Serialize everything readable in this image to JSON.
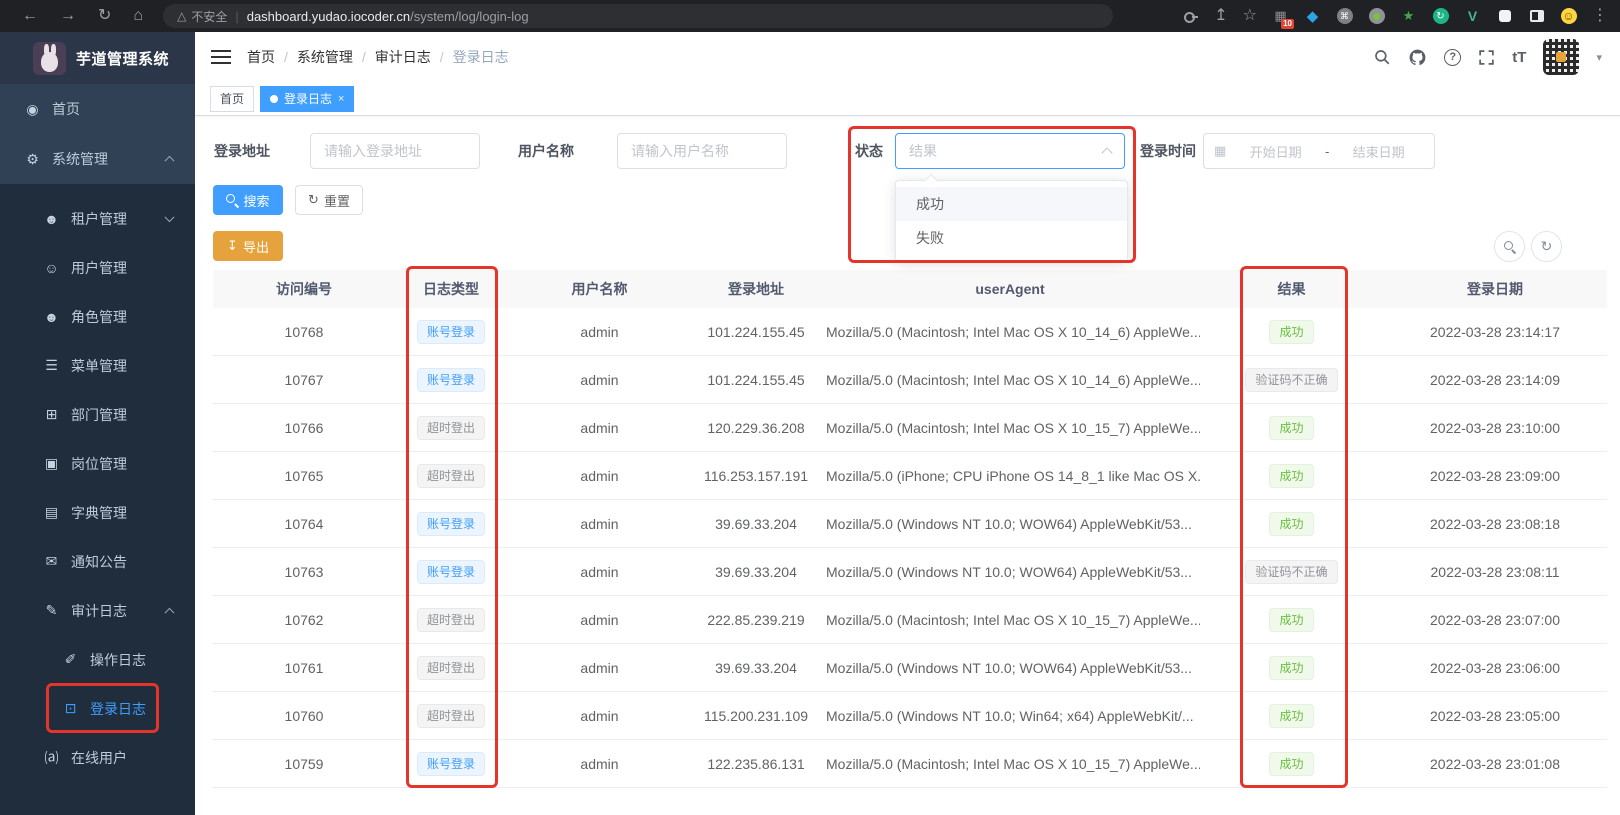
{
  "browser": {
    "security_text": "不安全",
    "url_host": "dashboard.yudao.iocoder.cn",
    "url_path": "/system/log/login-log",
    "extension_badge": "10"
  },
  "app": {
    "title": "芋道管理系统"
  },
  "icons": {
    "back": "←",
    "forward": "→",
    "reload": "↻",
    "home": "⌂",
    "warning_triangle": "△",
    "url_divider": "|",
    "share": "↥",
    "star": "☆",
    "browser_dots": "⋮",
    "ext_tiles": "▦",
    "ext_diamond": "◆",
    "ext_command": "⌘",
    "ext_star": "★",
    "ext_refresh": "↻",
    "ext_vue": "V",
    "ext_smiley": "☺",
    "help": "?",
    "font_size": "tT",
    "caret_down": "▾",
    "breadcrumb_sep": "/",
    "tab_close": "×",
    "reset": "↻",
    "export": "↧",
    "calendar": "▦",
    "refresh": "↻"
  },
  "breadcrumb": [
    "首页",
    "系统管理",
    "审计日志",
    "登录日志"
  ],
  "tabs": [
    {
      "name": "home",
      "label": "首页",
      "active": false,
      "closable": false
    },
    {
      "name": "login-log",
      "label": "登录日志",
      "active": true,
      "closable": true
    }
  ],
  "sidebar_menu": [
    {
      "name": "home",
      "label": "首页",
      "icon": "dashboard-icon",
      "glyph": "◉",
      "level": 0
    },
    {
      "name": "system-management",
      "label": "系统管理",
      "icon": "gear-icon",
      "glyph": "⚙",
      "level": 0,
      "arrow": "up"
    },
    {
      "name": "tenant-management",
      "label": "租户管理",
      "icon": "tenant-users-icon",
      "glyph": "☻",
      "level": 1,
      "arrow": "down"
    },
    {
      "name": "user-management",
      "label": "用户管理",
      "icon": "user-icon",
      "glyph": "☺",
      "level": 1
    },
    {
      "name": "role-management",
      "label": "角色管理",
      "icon": "role-users-icon",
      "glyph": "☻",
      "level": 1
    },
    {
      "name": "menu-management",
      "label": "菜单管理",
      "icon": "menu-tree-icon",
      "glyph": "☰",
      "level": 1
    },
    {
      "name": "dept-management",
      "label": "部门管理",
      "icon": "org-chart-icon",
      "glyph": "⊞",
      "level": 1
    },
    {
      "name": "post-management",
      "label": "岗位管理",
      "icon": "post-badge-icon",
      "glyph": "▣",
      "level": 1
    },
    {
      "name": "dict-management",
      "label": "字典管理",
      "icon": "dictionary-icon",
      "glyph": "▤",
      "level": 1
    },
    {
      "name": "notice",
      "label": "通知公告",
      "icon": "notice-message-icon",
      "glyph": "✉",
      "level": 1
    },
    {
      "name": "audit-log",
      "label": "审计日志",
      "icon": "audit-pencil-icon",
      "glyph": "✎",
      "level": 1,
      "arrow": "up"
    },
    {
      "name": "operation-log",
      "label": "操作日志",
      "icon": "operation-log-icon",
      "glyph": "✐",
      "level": 2
    },
    {
      "name": "login-log",
      "label": "登录日志",
      "icon": "login-log-icon",
      "glyph": "⊡",
      "level": 2,
      "active": true
    },
    {
      "name": "online-users",
      "label": "在线用户",
      "icon": "online-users-icon",
      "glyph": "⒜",
      "level": 1
    }
  ],
  "filters": {
    "login_address_label": "登录地址",
    "login_address_placeholder": "请输入登录地址",
    "username_label": "用户名称",
    "username_placeholder": "请输入用户名称",
    "status_label": "状态",
    "status_placeholder": "结果",
    "login_time_label": "登录时间",
    "date_start_placeholder": "开始日期",
    "date_separator": "-",
    "date_end_placeholder": "结束日期"
  },
  "status_dropdown": {
    "options": [
      {
        "label": "成功",
        "hover": true
      },
      {
        "label": "失败",
        "hover": false
      }
    ]
  },
  "toolbar": {
    "search_label": "搜索",
    "reset_label": "重置",
    "export_label": "导出"
  },
  "table": {
    "columns": [
      "访问编号",
      "日志类型",
      "用户名称",
      "登录地址",
      "userAgent",
      "结果",
      "登录日期"
    ],
    "rows": [
      {
        "id": "10768",
        "log_type": "账号登录",
        "log_type_variant": "blue",
        "username": "admin",
        "ip": "101.224.155.45",
        "user_agent": "Mozilla/5.0 (Macintosh; Intel Mac OS X 10_14_6) AppleWe...",
        "result": "成功",
        "result_variant": "green",
        "date": "2022-03-28 23:14:17"
      },
      {
        "id": "10767",
        "log_type": "账号登录",
        "log_type_variant": "blue",
        "username": "admin",
        "ip": "101.224.155.45",
        "user_agent": "Mozilla/5.0 (Macintosh; Intel Mac OS X 10_14_6) AppleWe...",
        "result": "验证码不正确",
        "result_variant": "grey",
        "date": "2022-03-28 23:14:09"
      },
      {
        "id": "10766",
        "log_type": "超时登出",
        "log_type_variant": "grey",
        "username": "admin",
        "ip": "120.229.36.208",
        "user_agent": "Mozilla/5.0 (Macintosh; Intel Mac OS X 10_15_7) AppleWe...",
        "result": "成功",
        "result_variant": "green",
        "date": "2022-03-28 23:10:00"
      },
      {
        "id": "10765",
        "log_type": "超时登出",
        "log_type_variant": "grey",
        "username": "admin",
        "ip": "116.253.157.191",
        "user_agent": "Mozilla/5.0 (iPhone; CPU iPhone OS 14_8_1 like Mac OS X...",
        "result": "成功",
        "result_variant": "green",
        "date": "2022-03-28 23:09:00"
      },
      {
        "id": "10764",
        "log_type": "账号登录",
        "log_type_variant": "blue",
        "username": "admin",
        "ip": "39.69.33.204",
        "user_agent": "Mozilla/5.0 (Windows NT 10.0; WOW64) AppleWebKit/53...",
        "result": "成功",
        "result_variant": "green",
        "date": "2022-03-28 23:08:18"
      },
      {
        "id": "10763",
        "log_type": "账号登录",
        "log_type_variant": "blue",
        "username": "admin",
        "ip": "39.69.33.204",
        "user_agent": "Mozilla/5.0 (Windows NT 10.0; WOW64) AppleWebKit/53...",
        "result": "验证码不正确",
        "result_variant": "grey",
        "date": "2022-03-28 23:08:11"
      },
      {
        "id": "10762",
        "log_type": "超时登出",
        "log_type_variant": "grey",
        "username": "admin",
        "ip": "222.85.239.219",
        "user_agent": "Mozilla/5.0 (Macintosh; Intel Mac OS X 10_15_7) AppleWe...",
        "result": "成功",
        "result_variant": "green",
        "date": "2022-03-28 23:07:00"
      },
      {
        "id": "10761",
        "log_type": "超时登出",
        "log_type_variant": "grey",
        "username": "admin",
        "ip": "39.69.33.204",
        "user_agent": "Mozilla/5.0 (Windows NT 10.0; WOW64) AppleWebKit/53...",
        "result": "成功",
        "result_variant": "green",
        "date": "2022-03-28 23:06:00"
      },
      {
        "id": "10760",
        "log_type": "超时登出",
        "log_type_variant": "grey",
        "username": "admin",
        "ip": "115.200.231.109",
        "user_agent": "Mozilla/5.0 (Windows NT 10.0; Win64; x64) AppleWebKit/...",
        "result": "成功",
        "result_variant": "green",
        "date": "2022-03-28 23:05:00"
      },
      {
        "id": "10759",
        "log_type": "账号登录",
        "log_type_variant": "blue",
        "username": "admin",
        "ip": "122.235.86.131",
        "user_agent": "Mozilla/5.0 (Macintosh; Intel Mac OS X 10_15_7) AppleWe...",
        "result": "成功",
        "result_variant": "green",
        "date": "2022-03-28 23:01:08"
      }
    ]
  },
  "colors": {
    "primary": "#409eff",
    "warning_button": "#e6a23c",
    "annotation_red": "#e5352b",
    "tag_success_text": "#67c23a",
    "tag_info_text": "#909399",
    "tag_primary_text": "#409eff",
    "sidebar_bg": "#304156",
    "sidebar_submenu_bg": "#1f2d3d"
  }
}
